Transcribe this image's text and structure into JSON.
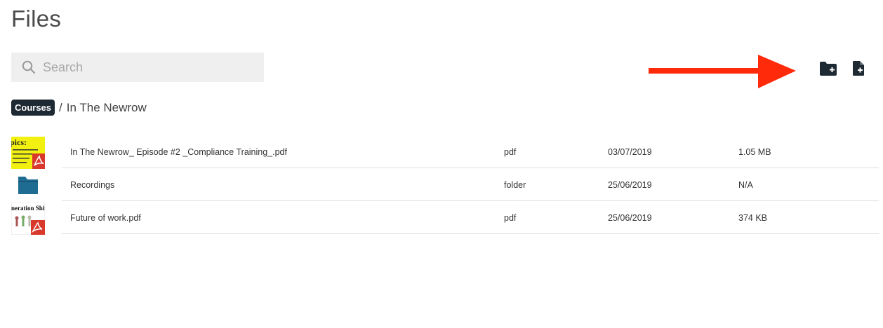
{
  "header": {
    "title": "Files"
  },
  "search": {
    "placeholder": "Search",
    "value": ""
  },
  "toolbar": {
    "new_folder_icon": "folder-plus-icon",
    "new_file_icon": "file-plus-icon"
  },
  "breadcrumb": {
    "root": "Courses",
    "separator": "/",
    "current": "In The Newrow"
  },
  "files": [
    {
      "name": "In The Newrow_ Episode #2 _Compliance Training_.pdf",
      "type": "pdf",
      "date": "03/07/2019",
      "size": "1.05 MB",
      "thumb_text": "pics:"
    },
    {
      "name": "Recordings",
      "type": "folder",
      "date": "25/06/2019",
      "size": "N/A"
    },
    {
      "name": "Future of work.pdf",
      "type": "pdf",
      "date": "25/06/2019",
      "size": "374 KB",
      "thumb_text": "eneration Shift"
    }
  ],
  "colors": {
    "annotation_arrow": "#ff2a0a",
    "folder": "#1f6c93",
    "chip": "#1e2a33",
    "pdf_badge": "#d9392c"
  }
}
